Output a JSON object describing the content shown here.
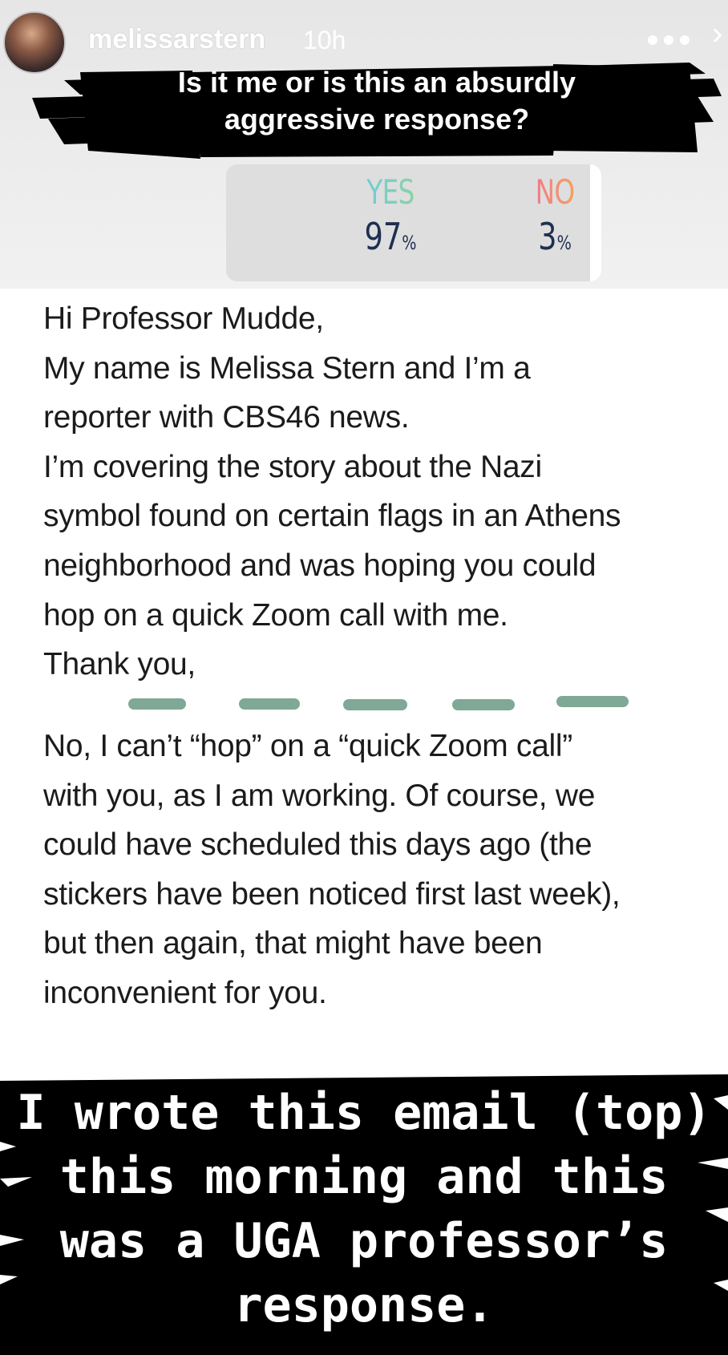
{
  "story_header": {
    "username": "melissarstern",
    "time_ago": "10h"
  },
  "question": {
    "line1": "Is it me or is this an absurdly",
    "line2": "aggressive response?"
  },
  "poll": {
    "options": [
      {
        "label": "YES",
        "percent": "97",
        "unit": "%"
      },
      {
        "label": "NO",
        "percent": "3",
        "unit": "%"
      }
    ]
  },
  "email": {
    "lines": [
      "Hi Professor Mudde,",
      "My name is Melissa Stern and I’m a",
      "reporter with CBS46 news.",
      "I’m covering the story about the Nazi",
      "symbol found on certain flags in an Athens",
      "neighborhood and was hoping you could",
      "hop on a quick Zoom call with me.",
      "Thank you,"
    ]
  },
  "reply": {
    "lines": [
      "No, I can’t “hop” on a “quick Zoom call”",
      "with you, as I am working. Of course, we",
      "could have scheduled this days ago (the",
      "stickers have been noticed first last week),",
      "but then again, that might have been",
      "inconvenient for you."
    ]
  },
  "caption": {
    "lines": [
      "I wrote this email (top)",
      "this morning and this",
      "was a UGA professor’s",
      "response."
    ]
  },
  "colors": {
    "separator": "#7fa896",
    "poll_bg": "#dedede",
    "poll_pct": "#1f2f52"
  }
}
